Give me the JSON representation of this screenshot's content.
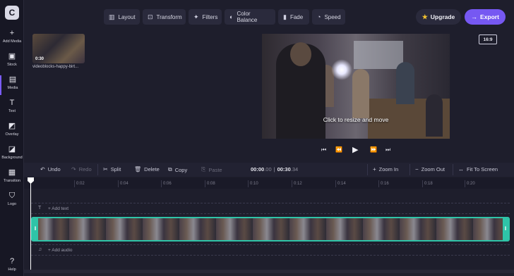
{
  "sidebar": {
    "items": [
      {
        "label": "Add Media",
        "icon": "plus-icon"
      },
      {
        "label": "Stock",
        "icon": "stock-icon"
      },
      {
        "label": "Media",
        "icon": "media-icon"
      },
      {
        "label": "Text",
        "icon": "text-icon"
      },
      {
        "label": "Overlay",
        "icon": "overlay-icon"
      },
      {
        "label": "Background",
        "icon": "background-icon"
      },
      {
        "label": "Transition",
        "icon": "transition-icon"
      },
      {
        "label": "Logo",
        "icon": "logo-icon"
      },
      {
        "label": "Help",
        "icon": "help-icon"
      }
    ]
  },
  "toolbar": {
    "layout": "Layout",
    "transform": "Transform",
    "filters": "Filters",
    "color_balance": "Color Balance",
    "fade": "Fade",
    "speed": "Speed",
    "upgrade": "Upgrade",
    "export": "Export"
  },
  "media": {
    "thumb_duration": "0:30",
    "thumb_name": "videoblocks-happy-birt..."
  },
  "preview": {
    "overlay_text": "Click to resize and move",
    "aspect_ratio": "16:9"
  },
  "timeline": {
    "undo": "Undo",
    "redo": "Redo",
    "split": "Split",
    "delete": "Delete",
    "copy": "Copy",
    "paste": "Paste",
    "current_time": "00:00",
    "current_frames": ".00",
    "total_time": "00:30",
    "total_frames": ".34",
    "zoom_in": "Zoom In",
    "zoom_out": "Zoom Out",
    "fit": "Fit To Screen",
    "ticks": [
      "0:02",
      "0:04",
      "0:06",
      "0:08",
      "0:10",
      "0:12",
      "0:14",
      "0:16",
      "0:18",
      "0:20"
    ],
    "add_text": "+ Add text",
    "add_audio": "+ Add audio"
  },
  "colors": {
    "accent": "#7658f2",
    "clip_border": "#2fc4a8",
    "upgrade_star": "#f2c230"
  }
}
